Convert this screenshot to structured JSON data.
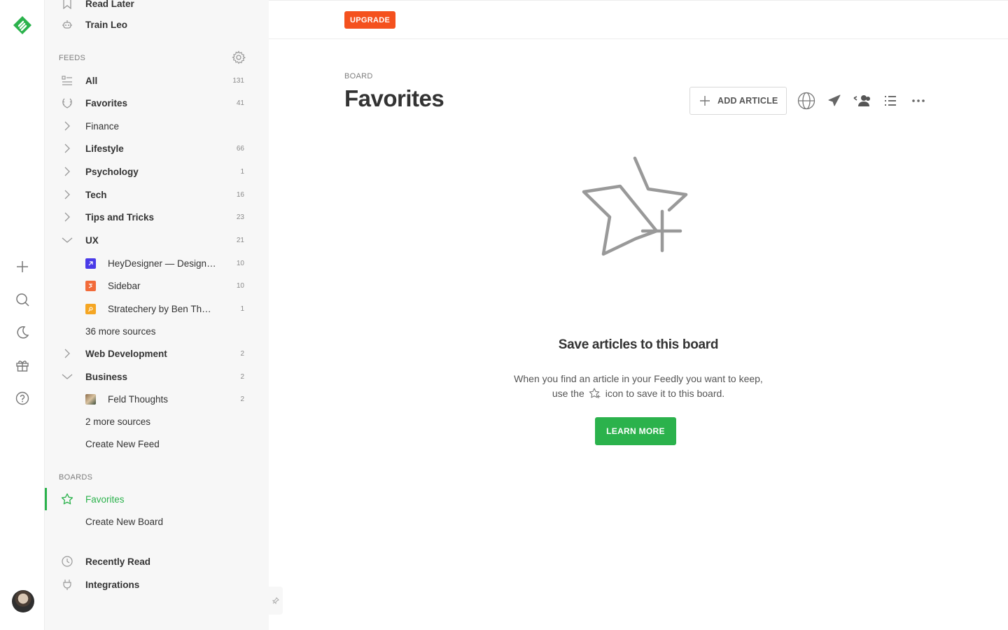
{
  "sidebar": {
    "top_items": [
      {
        "label": "Read Later",
        "icon": "bookmark-icon"
      },
      {
        "label": "Train Leo",
        "icon": "robot-icon"
      }
    ],
    "feeds_label": "FEEDS",
    "feeds": {
      "all": {
        "label": "All",
        "count": "131"
      },
      "favorites": {
        "label": "Favorites",
        "count": "41"
      },
      "finance": {
        "label": "Finance",
        "count": ""
      },
      "lifestyle": {
        "label": "Lifestyle",
        "count": "66"
      },
      "psychology": {
        "label": "Psychology",
        "count": "1"
      },
      "tech": {
        "label": "Tech",
        "count": "16"
      },
      "tips": {
        "label": "Tips and Tricks",
        "count": "23"
      },
      "ux": {
        "label": "UX",
        "count": "21"
      },
      "heydesigner": {
        "label": "HeyDesigner — Design …",
        "count": "10"
      },
      "sidebar_src": {
        "label": "Sidebar",
        "count": "10"
      },
      "stratechery": {
        "label": "Stratechery by Ben Tho…",
        "count": "1"
      },
      "ux_more": {
        "label": "36 more sources"
      },
      "webdev": {
        "label": "Web Development",
        "count": "2"
      },
      "business": {
        "label": "Business",
        "count": "2"
      },
      "feld": {
        "label": "Feld Thoughts",
        "count": "2"
      },
      "biz_more": {
        "label": "2 more sources"
      },
      "create_feed": {
        "label": "Create New Feed"
      }
    },
    "boards_label": "BOARDS",
    "boards": {
      "favorites": {
        "label": "Favorites"
      },
      "create_board": {
        "label": "Create New Board"
      }
    },
    "bottom": {
      "recently_read": {
        "label": "Recently Read"
      },
      "integrations": {
        "label": "Integrations"
      }
    }
  },
  "topbar": {
    "upgrade_label": "UPGRADE"
  },
  "main": {
    "eyebrow": "BOARD",
    "title": "Favorites",
    "add_article_label": "ADD ARTICLE",
    "empty": {
      "title": "Save articles to this board",
      "desc_line1": "When you find an article in your Feedly you want to keep,",
      "desc_line2_before": "use the",
      "desc_line2_after": "icon to save it to this board.",
      "learn_more": "LEARN MORE"
    }
  },
  "colors": {
    "accent": "#2bb24c",
    "upgrade": "#f4511e",
    "sidebar_bg": "#f7f7f7"
  }
}
